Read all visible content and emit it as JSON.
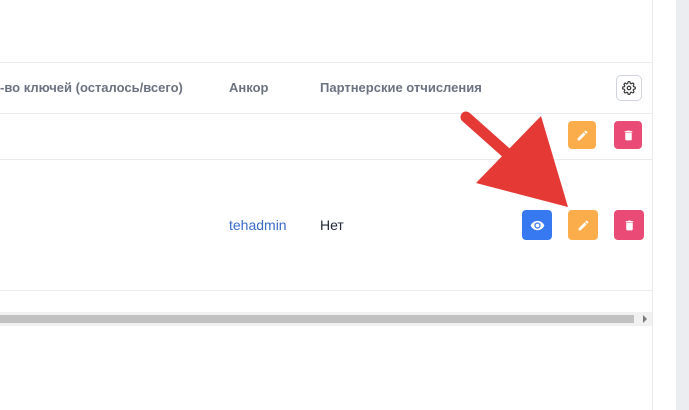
{
  "table": {
    "columns": [
      {
        "label": "-во ключей (осталось/всего)"
      },
      {
        "label": "Анкор"
      },
      {
        "label": "Партнерские отчисления"
      }
    ],
    "settings_icon": "gear-icon",
    "rows": [
      {
        "anchor": "",
        "partner": "",
        "actions": [
          "edit",
          "delete"
        ]
      },
      {
        "anchor": "tehadmin",
        "partner": "Нет",
        "actions": [
          "view",
          "edit",
          "delete"
        ]
      }
    ]
  },
  "annotation": {
    "arrow_color": "#e53935",
    "arrow_target": "edit-button"
  },
  "colors": {
    "view": "#3779f1",
    "edit": "#fbad4c",
    "delete": "#e94b76",
    "link": "#3a6bc6"
  }
}
